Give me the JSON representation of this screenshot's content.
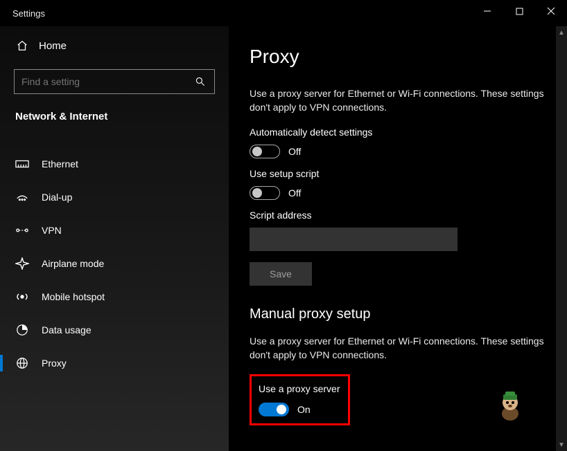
{
  "window": {
    "title": "Settings"
  },
  "sidebar": {
    "home": "Home",
    "search_placeholder": "Find a setting",
    "group": "Network & Internet",
    "items": [
      {
        "label": "Ethernet"
      },
      {
        "label": "Dial-up"
      },
      {
        "label": "VPN"
      },
      {
        "label": "Airplane mode"
      },
      {
        "label": "Mobile hotspot"
      },
      {
        "label": "Data usage"
      },
      {
        "label": "Proxy"
      }
    ]
  },
  "page": {
    "heading": "Proxy",
    "desc1": "Use a proxy server for Ethernet or Wi-Fi connections. These settings don't apply to VPN connections.",
    "auto_detect_label": "Automatically detect settings",
    "auto_detect_state": "Off",
    "setup_script_label": "Use setup script",
    "setup_script_state": "Off",
    "script_address_label": "Script address",
    "script_address_value": "",
    "save_label": "Save",
    "manual_heading": "Manual proxy setup",
    "desc2": "Use a proxy server for Ethernet or Wi-Fi connections. These settings don't apply to VPN connections.",
    "use_proxy_label": "Use a proxy server",
    "use_proxy_state": "On"
  }
}
